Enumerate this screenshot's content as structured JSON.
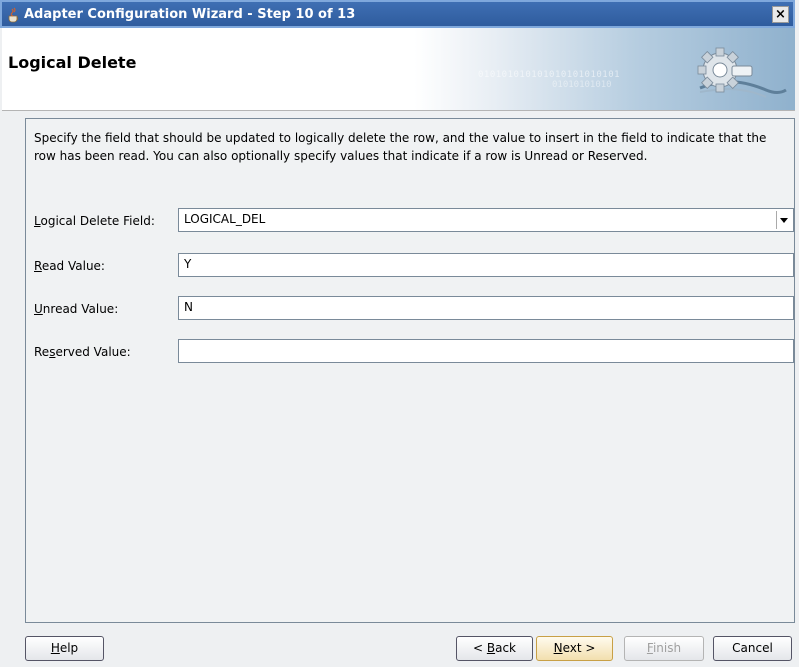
{
  "window": {
    "title": "Adapter Configuration Wizard - Step 10 of 13",
    "close_label": "×"
  },
  "header": {
    "page_title": "Logical Delete",
    "banner_bits_1": "010101010101010101010101",
    "banner_bits_2": "01010101010"
  },
  "panel": {
    "description": "Specify the field that should be updated to logically delete the row, and the value to insert in the field to indicate that the row has been read.  You can also optionally specify values that indicate if a row is Unread or Reserved.",
    "fields": {
      "logical_delete": {
        "label_pre": "",
        "label_mn": "L",
        "label_post": "ogical Delete Field:",
        "value": "LOGICAL_DEL"
      },
      "read": {
        "label_pre": "",
        "label_mn": "R",
        "label_post": "ead Value:",
        "value": "Y"
      },
      "unread": {
        "label_pre": "",
        "label_mn": "U",
        "label_post": "nread Value:",
        "value": "N"
      },
      "reserved": {
        "label_pre": "Re",
        "label_mn": "s",
        "label_post": "erved Value:",
        "value": ""
      }
    }
  },
  "buttons": {
    "help": {
      "pre": "",
      "mn": "H",
      "post": "elp"
    },
    "back": {
      "pre": "< ",
      "mn": "B",
      "post": "ack"
    },
    "next": {
      "pre": "",
      "mn": "N",
      "post": "ext >"
    },
    "finish": {
      "pre": "",
      "mn": "F",
      "post": "inish"
    },
    "cancel": {
      "pre": "Cancel",
      "mn": "",
      "post": ""
    }
  }
}
